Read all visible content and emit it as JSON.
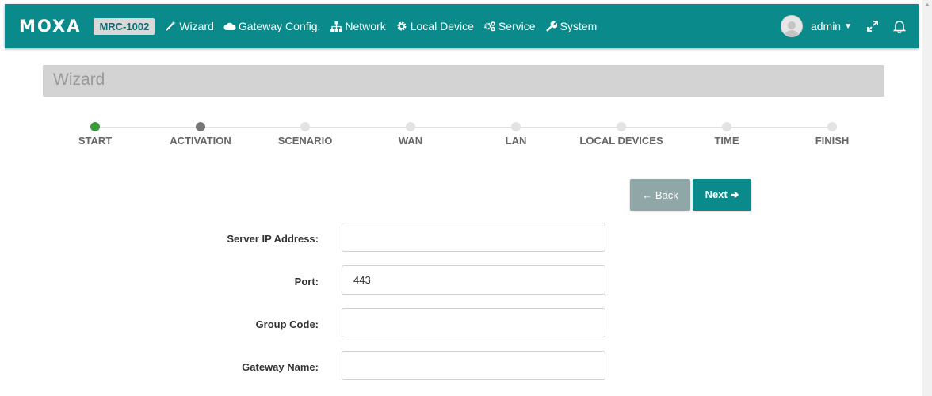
{
  "header": {
    "logo": "MOXA",
    "model": "MRC-1002",
    "nav": [
      {
        "label": "Wizard",
        "icon": "magic-wand-icon"
      },
      {
        "label": "Gateway Config.",
        "icon": "cloud-icon"
      },
      {
        "label": "Network",
        "icon": "sitemap-icon"
      },
      {
        "label": "Local Device",
        "icon": "gear-icon"
      },
      {
        "label": "Service",
        "icon": "gears-icon"
      },
      {
        "label": "System",
        "icon": "wrench-icon"
      }
    ],
    "user": "admin",
    "accent": "#0b8a8c"
  },
  "page": {
    "title": "Wizard"
  },
  "steps": [
    {
      "label": "START",
      "state": "done"
    },
    {
      "label": "ACTIVATION",
      "state": "current"
    },
    {
      "label": "SCENARIO",
      "state": "pending"
    },
    {
      "label": "WAN",
      "state": "pending"
    },
    {
      "label": "LAN",
      "state": "pending"
    },
    {
      "label": "LOCAL DEVICES",
      "state": "pending"
    },
    {
      "label": "TIME",
      "state": "pending"
    },
    {
      "label": "FINISH",
      "state": "pending"
    }
  ],
  "buttons": {
    "back": "← Back",
    "next": "Next ➔"
  },
  "form": {
    "server_ip": {
      "label": "Server IP Address:",
      "value": ""
    },
    "port": {
      "label": "Port:",
      "value": "443"
    },
    "group_code": {
      "label": "Group Code:",
      "value": ""
    },
    "gateway_name": {
      "label": "Gateway Name:",
      "value": ""
    }
  }
}
